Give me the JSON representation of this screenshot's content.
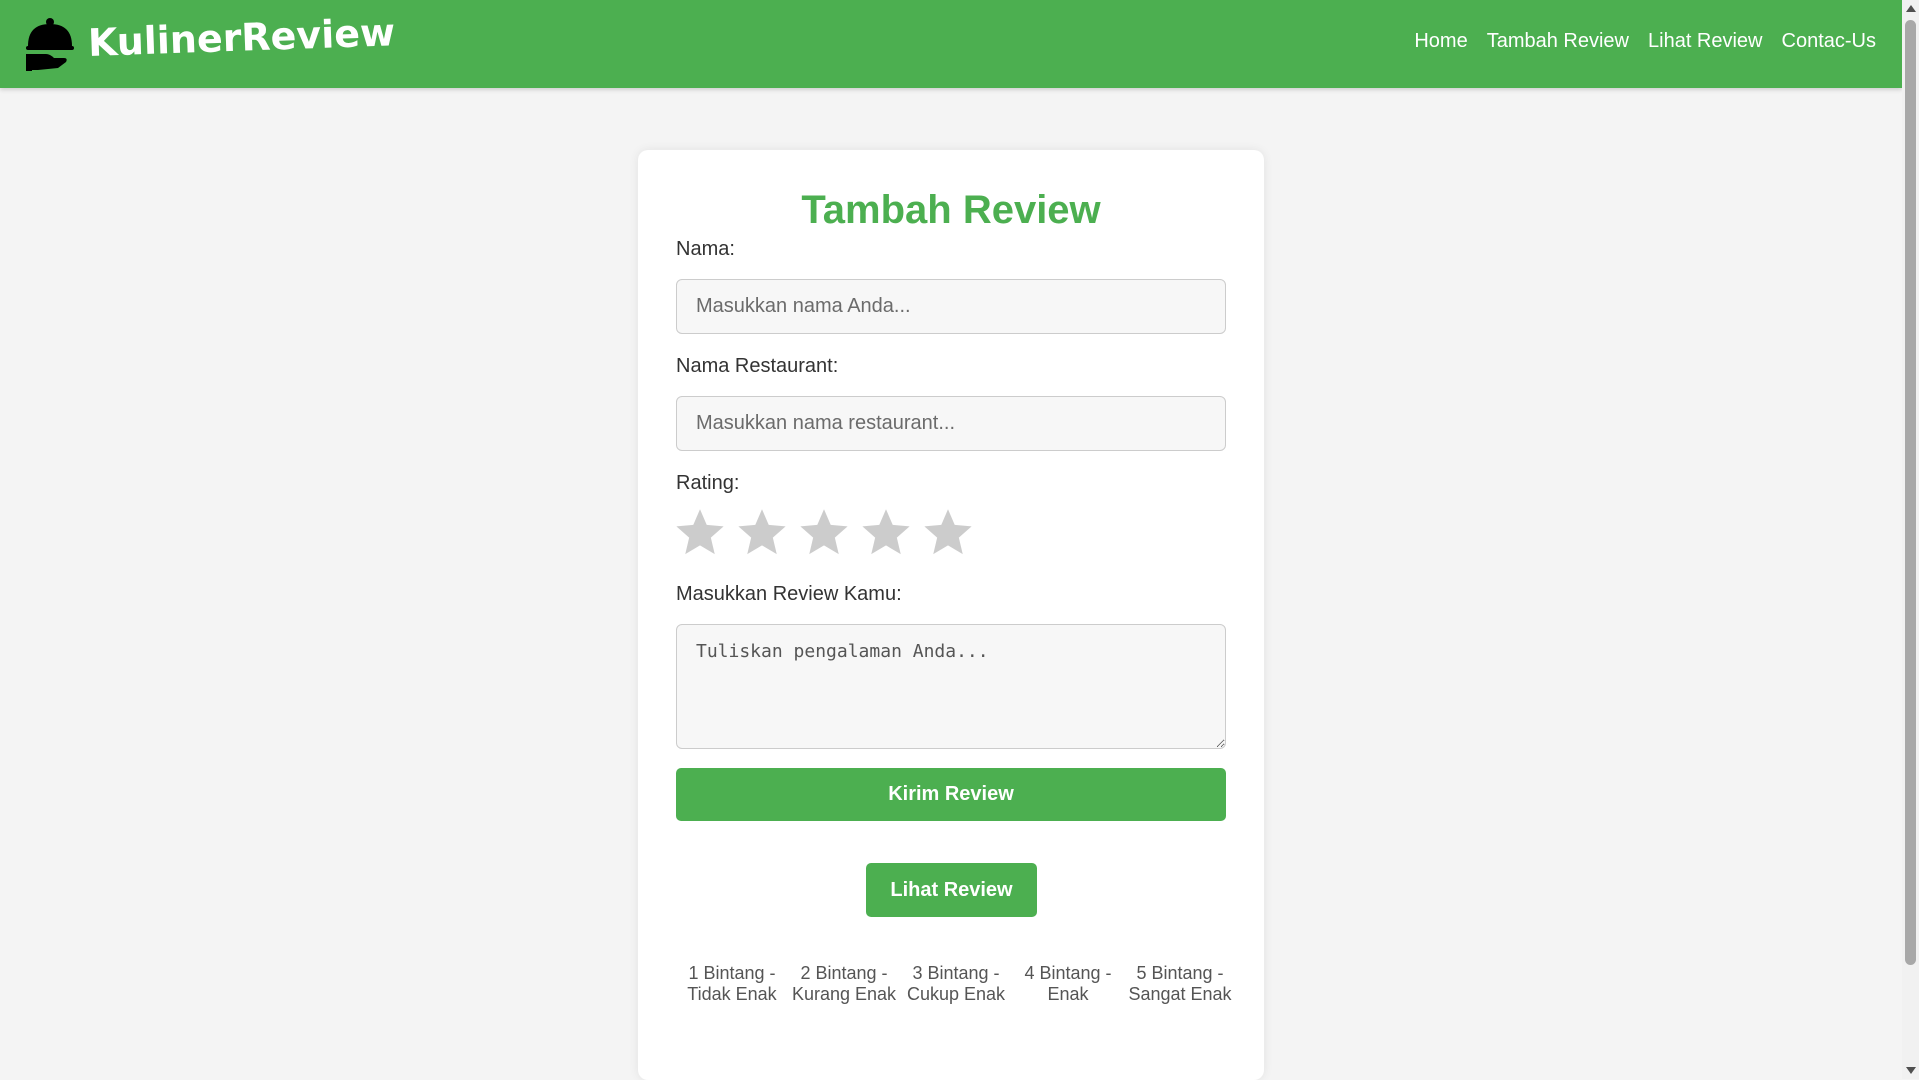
{
  "navbar": {
    "brand": "KulinerReview",
    "logo_icon": "cloche-icon",
    "links": [
      "Home",
      "Tambah Review",
      "Lihat Review",
      "Contac-Us"
    ]
  },
  "form": {
    "title": "Tambah Review",
    "name_label": "Nama:",
    "name_placeholder": "Masukkan nama Anda...",
    "restaurant_label": "Nama Restaurant:",
    "restaurant_placeholder": "Masukkan nama restaurant...",
    "rating_label": "Rating:",
    "rating_value": 0,
    "rating_max": 5,
    "review_label": "Masukkan Review Kamu:",
    "review_placeholder": "Tuliskan pengalaman Anda...",
    "submit_label": "Kirim Review",
    "view_label": "Lihat Review"
  },
  "legend": [
    "1 Bintang - Tidak Enak",
    "2 Bintang - Kurang Enak",
    "3 Bintang - Cukup Enak",
    "4 Bintang - Enak",
    "5 Bintang - Sangat Enak"
  ],
  "colors": {
    "accent": "#4caf50",
    "star_inactive": "#cccccc",
    "background": "#f4f4f4"
  }
}
